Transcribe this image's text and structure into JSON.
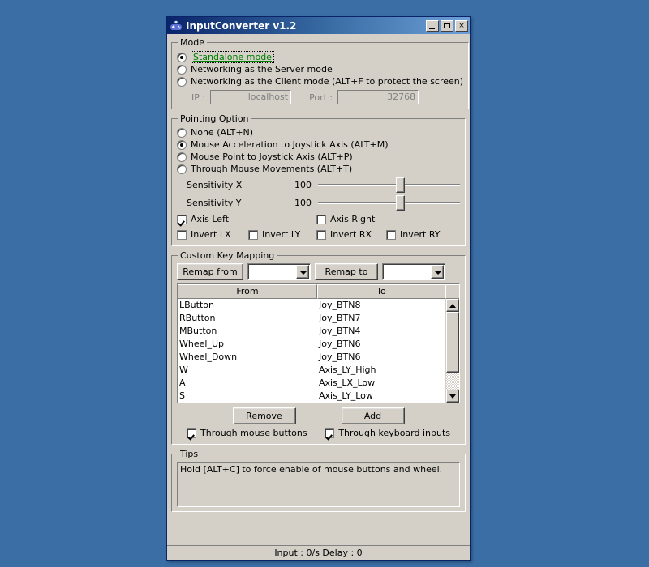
{
  "window": {
    "title": "InputConverter v1.2",
    "icon": "gamepad-icon",
    "minimize_label": "_",
    "maximize_label": "□",
    "close_label": "×"
  },
  "mode": {
    "legend": "Mode",
    "options": [
      {
        "label": "Standalone mode",
        "selected": true,
        "focused": true
      },
      {
        "label": "Networking as the Server mode",
        "selected": false,
        "focused": false
      },
      {
        "label": "Networking as the Client mode (ALT+F to protect the screen)",
        "selected": false,
        "focused": false
      }
    ],
    "ip_label": "IP :",
    "ip_value": "localhost",
    "port_label": "Port :",
    "port_value": "32768"
  },
  "pointing": {
    "legend": "Pointing Option",
    "options": [
      {
        "label": "None (ALT+N)",
        "selected": false
      },
      {
        "label": "Mouse Acceleration to Joystick Axis (ALT+M)",
        "selected": true
      },
      {
        "label": "Mouse Point to Joystick Axis (ALT+P)",
        "selected": false
      },
      {
        "label": "Through Mouse Movements (ALT+T)",
        "selected": false
      }
    ],
    "sliders": [
      {
        "name": "Sensitivity X",
        "value": "100",
        "percent": 58
      },
      {
        "name": "Sensitivity Y",
        "value": "100",
        "percent": 58
      }
    ],
    "axis_checks": [
      {
        "label": "Axis Left",
        "checked": true
      },
      {
        "label": "Axis Right",
        "checked": false
      }
    ],
    "invert_checks": [
      {
        "label": "Invert LX",
        "checked": false
      },
      {
        "label": "Invert LY",
        "checked": false
      },
      {
        "label": "Invert RX",
        "checked": false
      },
      {
        "label": "Invert RY",
        "checked": false
      }
    ]
  },
  "mapping": {
    "legend": "Custom Key Mapping",
    "remap_from_label": "Remap from",
    "remap_from_value": "",
    "remap_to_label": "Remap to",
    "remap_to_value": "",
    "columns": [
      "From",
      "To"
    ],
    "rows": [
      {
        "from": "LButton",
        "to": "Joy_BTN8"
      },
      {
        "from": "RButton",
        "to": "Joy_BTN7"
      },
      {
        "from": "MButton",
        "to": "Joy_BTN4"
      },
      {
        "from": "Wheel_Up",
        "to": "Joy_BTN6"
      },
      {
        "from": "Wheel_Down",
        "to": "Joy_BTN6"
      },
      {
        "from": "W",
        "to": "Axis_LY_High"
      },
      {
        "from": "A",
        "to": "Axis_LX_Low"
      },
      {
        "from": "S",
        "to": "Axis_LY_Low"
      }
    ],
    "remove_label": "Remove",
    "add_label": "Add",
    "through_mouse": {
      "label": "Through mouse buttons",
      "checked": true
    },
    "through_keyboard": {
      "label": "Through keyboard inputs",
      "checked": true
    }
  },
  "tips": {
    "legend": "Tips",
    "text": "Hold [ALT+C] to force enable of mouse buttons and wheel."
  },
  "statusbar": {
    "text": "Input : 0/s Delay : 0"
  }
}
